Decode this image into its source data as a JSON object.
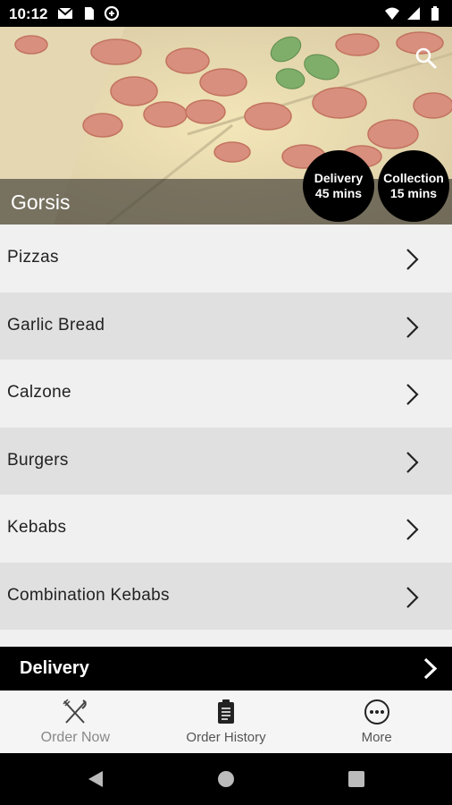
{
  "status_bar": {
    "time": "10:12",
    "left_icons": [
      "gmail-icon",
      "sim-card-icon",
      "data-saver-icon"
    ],
    "right_icons": [
      "wifi-icon",
      "signal-icon",
      "battery-icon"
    ]
  },
  "hero": {
    "restaurant_name": "Gorsis",
    "badges": [
      {
        "line1": "Delivery",
        "line2": "45 mins"
      },
      {
        "line1": "Collection",
        "line2": "15 mins"
      }
    ],
    "search_icon": "search-icon"
  },
  "categories": [
    {
      "label": "Pizzas"
    },
    {
      "label": "Garlic Bread"
    },
    {
      "label": "Calzone"
    },
    {
      "label": "Burgers"
    },
    {
      "label": "Kebabs"
    },
    {
      "label": "Combination Kebabs"
    },
    {
      "label": ""
    }
  ],
  "delivery_bar": {
    "label": "Delivery"
  },
  "bottom_nav": [
    {
      "label": "Order Now",
      "icon": "fork-knife-icon"
    },
    {
      "label": "Order History",
      "icon": "clipboard-icon"
    },
    {
      "label": "More",
      "icon": "more-icon"
    }
  ],
  "colors": {
    "bar_black": "#000000",
    "row_light": "#f0f0f0",
    "row_dark": "#e0e0e0"
  }
}
